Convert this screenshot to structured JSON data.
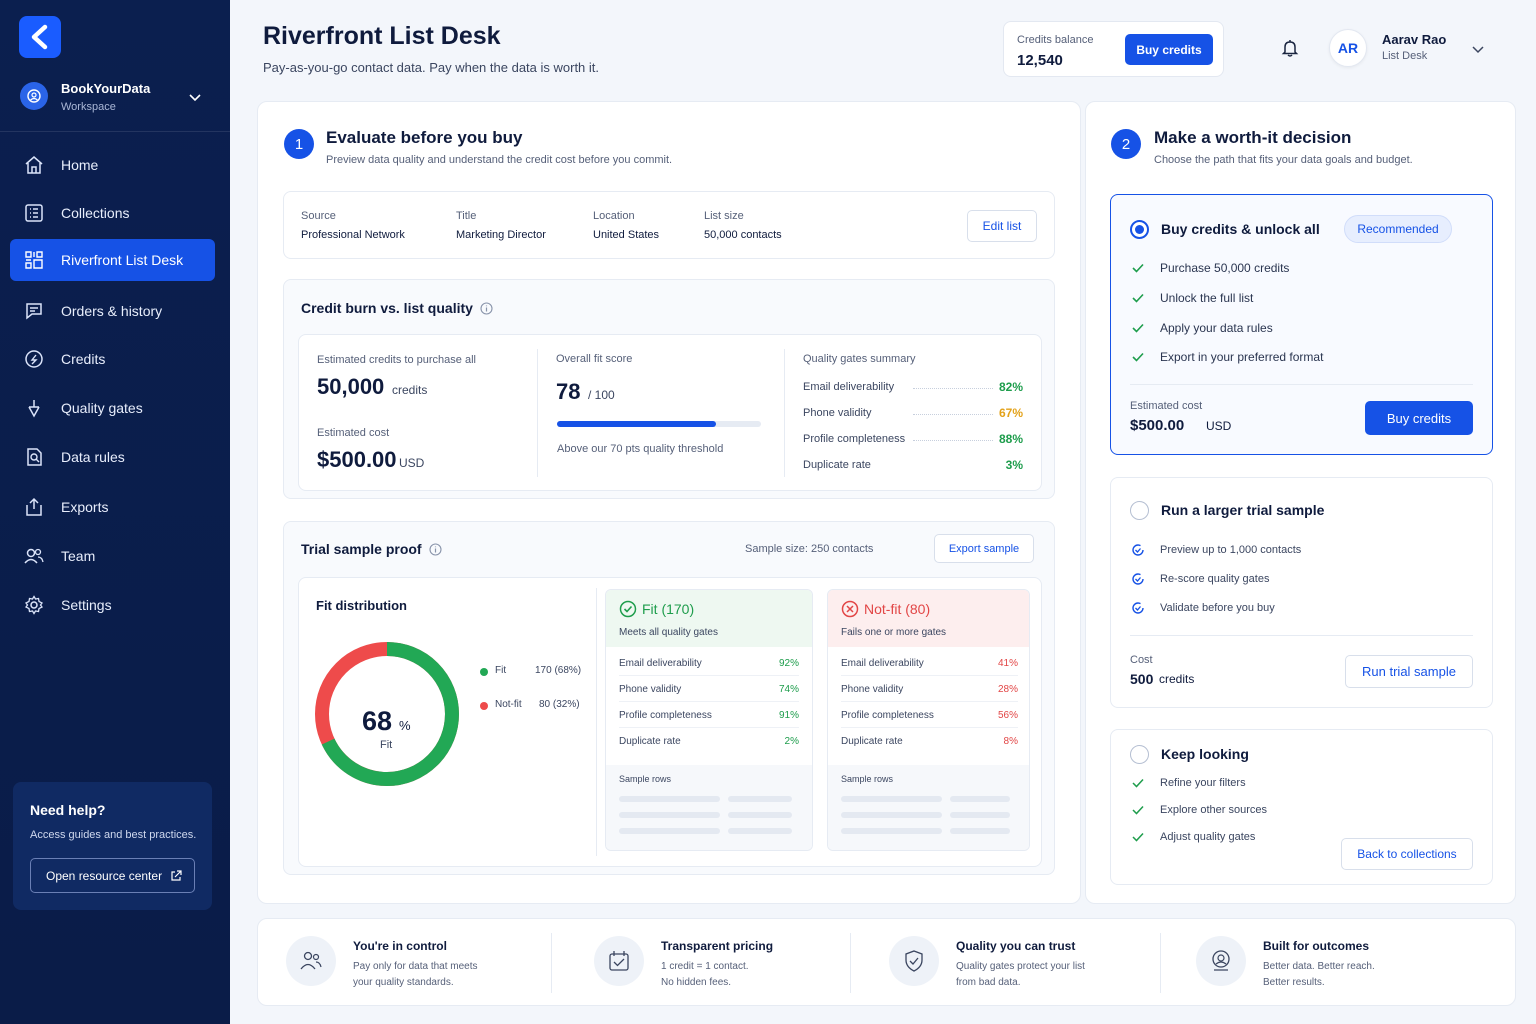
{
  "sidebar": {
    "workspace_name": "BookYourData",
    "workspace_type": "Workspace",
    "nav": [
      {
        "label": "Home",
        "icon": "home-icon"
      },
      {
        "label": "Collections",
        "icon": "collections-icon"
      },
      {
        "label": "Riverfront List Desk",
        "icon": "list-desk-icon",
        "active": true
      },
      {
        "label": "Orders & history",
        "icon": "orders-icon"
      },
      {
        "label": "Credits",
        "icon": "credits-icon"
      },
      {
        "label": "Quality gates",
        "icon": "quality-gates-icon"
      },
      {
        "label": "Data rules",
        "icon": "data-rules-icon"
      },
      {
        "label": "Exports",
        "icon": "exports-icon"
      },
      {
        "label": "Team",
        "icon": "team-icon"
      },
      {
        "label": "Settings",
        "icon": "settings-icon"
      }
    ],
    "help": {
      "title": "Need help?",
      "subtitle": "Access guides and best practices.",
      "button": "Open resource center"
    }
  },
  "header": {
    "title": "Riverfront List Desk",
    "subtitle": "Pay-as-you-go contact data. Pay when the data is worth it.",
    "credits_label": "Credits balance",
    "credits_value": "12,540",
    "buy_button": "Buy credits",
    "user_initials": "AR",
    "user_name": "Aarav Rao",
    "user_role": "List Desk"
  },
  "evaluate": {
    "step": "1",
    "title": "Evaluate before you buy",
    "subtitle": "Preview data quality and understand the credit cost before you commit.",
    "filters": [
      {
        "label": "Source",
        "value": "Professional Network"
      },
      {
        "label": "Title",
        "value": "Marketing Director"
      },
      {
        "label": "Location",
        "value": "United States"
      },
      {
        "label": "List size",
        "value": "50,000 contacts"
      }
    ],
    "edit_button": "Edit list",
    "burn": {
      "title": "Credit burn vs. list quality",
      "est_credits_label": "Estimated credits to purchase all",
      "est_credits_value": "50,000",
      "est_credits_unit": "credits",
      "est_cost_label": "Estimated cost",
      "est_cost_value": "$500.00",
      "est_cost_unit": "USD",
      "fit_label": "Overall fit score",
      "fit_value": "78",
      "fit_max": "/ 100",
      "fit_fraction": 0.78,
      "fit_note": "Above our 70 pts quality threshold",
      "gates_title": "Quality gates summary",
      "gates": [
        {
          "name": "Email deliverability",
          "value": "82%",
          "tone": "g"
        },
        {
          "name": "Phone validity",
          "value": "67%",
          "tone": "o"
        },
        {
          "name": "Profile completeness",
          "value": "88%",
          "tone": "g"
        },
        {
          "name": "Duplicate rate",
          "value": "3%",
          "tone": "g"
        }
      ]
    },
    "trial": {
      "title": "Trial sample proof",
      "sample_size": "Sample size: 250 contacts",
      "export_button": "Export sample",
      "dist_title": "Fit distribution",
      "donut_value": "68",
      "donut_unit": "%",
      "donut_label": "Fit",
      "fit_fraction": 0.68,
      "legend": [
        {
          "name": "Fit",
          "value": "170 (68%)",
          "color": "#22a855"
        },
        {
          "name": "Not-fit",
          "value": "80 (32%)",
          "color": "#ee4b4b"
        }
      ],
      "fit_card": {
        "title": "Fit (170)",
        "subtitle": "Meets all quality gates",
        "rows": [
          {
            "name": "Email deliverability",
            "value": "92%"
          },
          {
            "name": "Phone validity",
            "value": "74%"
          },
          {
            "name": "Profile completeness",
            "value": "91%"
          },
          {
            "name": "Duplicate rate",
            "value": "2%"
          }
        ],
        "sample_rows": "Sample rows"
      },
      "notfit_card": {
        "title": "Not-fit (80)",
        "subtitle": "Fails one or more gates",
        "rows": [
          {
            "name": "Email deliverability",
            "value": "41%"
          },
          {
            "name": "Phone validity",
            "value": "28%"
          },
          {
            "name": "Profile completeness",
            "value": "56%"
          },
          {
            "name": "Duplicate rate",
            "value": "8%"
          }
        ],
        "sample_rows": "Sample rows"
      }
    }
  },
  "decision": {
    "step": "2",
    "title": "Make a worth-it decision",
    "subtitle": "Choose the path that fits your data goals and budget.",
    "buy": {
      "title": "Buy credits & unlock all",
      "badge": "Recommended",
      "items": [
        "Purchase 50,000 credits",
        "Unlock the full list",
        "Apply your data rules",
        "Export in your preferred format"
      ],
      "cost_label": "Estimated cost",
      "cost_value": "$500.00",
      "cost_unit": "USD",
      "button": "Buy credits"
    },
    "trial": {
      "title": "Run a larger trial sample",
      "items": [
        "Preview up to 1,000 contacts",
        "Re-score quality gates",
        "Validate before you buy"
      ],
      "cost_label": "Cost",
      "cost_value": "500",
      "cost_unit": "credits",
      "button": "Run trial sample"
    },
    "keep": {
      "title": "Keep looking",
      "items": [
        "Refine your filters",
        "Explore other sources",
        "Adjust quality gates"
      ],
      "button": "Back to collections"
    }
  },
  "footer": [
    {
      "title": "You're in control",
      "line1": "Pay only for data that meets",
      "line2": "your quality standards.",
      "icon": "control-icon"
    },
    {
      "title": "Transparent pricing",
      "line1": "1 credit = 1 contact.",
      "line2": "No hidden fees.",
      "icon": "pricing-icon"
    },
    {
      "title": "Quality you can trust",
      "line1": "Quality gates protect your list",
      "line2": "from bad data.",
      "icon": "shield-icon"
    },
    {
      "title": "Built for outcomes",
      "line1": "Better data. Better reach.",
      "line2": "Better results.",
      "icon": "outcomes-icon"
    }
  ],
  "colors": {
    "accent": "#1652e6",
    "sidebar": "#0b1f4f",
    "fit": "#22a855",
    "notfit": "#ee4b4b"
  }
}
